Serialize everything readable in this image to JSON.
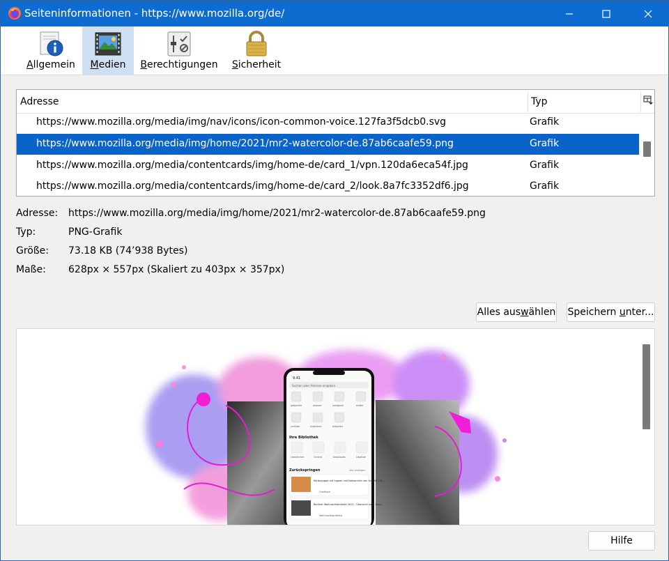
{
  "window": {
    "title": "Seiteninformationen - https://www.mozilla.org/de/",
    "accent": "#0e6bd0",
    "selection_color": "#0a63c9"
  },
  "toolbar": {
    "tabs": [
      {
        "pre": "",
        "u": "A",
        "post": "llgemein",
        "icon": "info-icon"
      },
      {
        "pre": "",
        "u": "M",
        "post": "edien",
        "icon": "media-icon"
      },
      {
        "pre": "",
        "u": "B",
        "post": "erechtigungen",
        "icon": "permissions-icon"
      },
      {
        "pre": "",
        "u": "S",
        "post": "icherheit",
        "icon": "lock-icon"
      }
    ],
    "active_tab": "Medien"
  },
  "media_list": {
    "columns": {
      "address": "Adresse",
      "type": "Typ"
    },
    "rows": [
      {
        "address": "https://www.mozilla.org/media/img/nav/icons/icon-common-voice.127fa3f5dcb0.svg",
        "type": "Grafik"
      },
      {
        "address": "https://www.mozilla.org/media/img/home/2021/mr2-watercolor-de.87ab6caafe59.png",
        "type": "Grafik"
      },
      {
        "address": "https://www.mozilla.org/media/contentcards/img/home-de/card_1/vpn.120da6eca54f.jpg",
        "type": "Grafik"
      },
      {
        "address": "https://www.mozilla.org/media/contentcards/img/home-de/card_2/look.8a7fc3352df6.jpg",
        "type": "Grafik"
      }
    ],
    "selected_index": 1
  },
  "details": {
    "address_label": "Adresse:",
    "address_value": "https://www.mozilla.org/media/img/home/2021/mr2-watercolor-de.87ab6caafe59.png",
    "type_label": "Typ:",
    "type_value": "PNG-Grafik",
    "size_label": "Größe:",
    "size_value": "73.18 KB (74’938 Bytes)",
    "dims_label": "Maße:",
    "dims_value": "628px × 557px (Skaliert zu 403px × 357px)"
  },
  "actions": {
    "select_all": {
      "pre": "Alles aus",
      "u": "w",
      "post": "ählen"
    },
    "save_as": {
      "pre": "Speichern ",
      "u": "u",
      "post": "nter..."
    },
    "help": "Hilfe"
  },
  "preview": {
    "phone": {
      "time": "9:41",
      "search_placeholder": "Suchen oder Adresse eingeben",
      "row1": [
        "getpocket",
        "amazon",
        "instagram",
        "twitter"
      ],
      "row2": [
        "youtube",
        "kingfuture",
        "wikipedia"
      ],
      "library_title": "Ihre Bibliothek",
      "library_items": [
        "Lesezeichen",
        "Chronik",
        "Downloads",
        "Leseliste"
      ],
      "jump_title": "Zurückspringen",
      "show_all": "Alle anzeigen",
      "card1_title": "Kürbissuppe mit Ingwer und Kokosmilch von UrlikeM | Ch...",
      "card1_source": "Chefkoch",
      "card2_title": "Berliner Weihnachtsmärkte 2021 - Übersicht nach Datu...",
      "card2_source": "Weihnachtsmärkte"
    }
  }
}
